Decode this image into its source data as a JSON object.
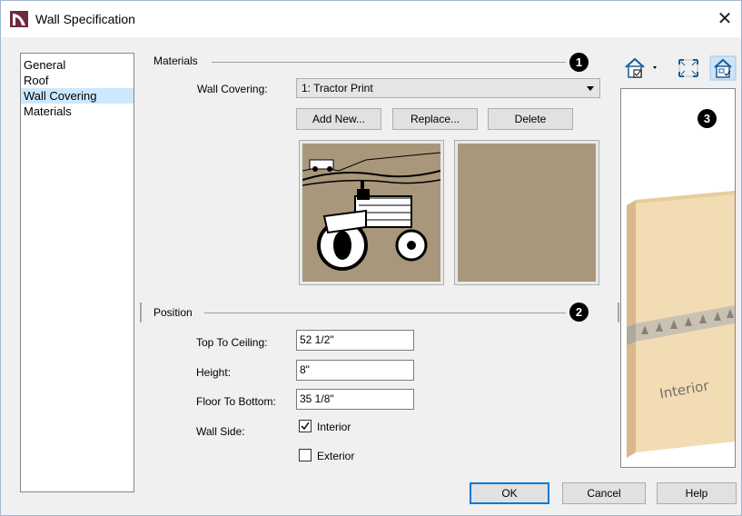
{
  "window": {
    "title": "Wall Specification"
  },
  "nav": {
    "items": [
      {
        "label": "General",
        "selected": false
      },
      {
        "label": "Roof",
        "selected": false
      },
      {
        "label": "Wall Covering",
        "selected": true
      },
      {
        "label": "Materials",
        "selected": false
      }
    ]
  },
  "materials": {
    "group_label": "Materials",
    "badge": "1",
    "wall_covering_label": "Wall Covering:",
    "wall_covering_value": "1:  Tractor Print",
    "add_new_label": "Add New...",
    "replace_label": "Replace...",
    "delete_label": "Delete",
    "swatch_color": "#a8977a"
  },
  "position": {
    "group_label": "Position",
    "badge": "2",
    "top_to_ceiling_label": "Top To Ceiling:",
    "top_to_ceiling_value": "52 1/2\"",
    "height_label": "Height:",
    "height_value": "8\"",
    "floor_to_bottom_label": "Floor To Bottom:",
    "floor_to_bottom_value": "35 1/8\"",
    "wall_side_label": "Wall Side:",
    "interior_label": "Interior",
    "interior_checked": true,
    "exterior_label": "Exterior",
    "exterior_checked": false
  },
  "preview": {
    "badge": "3",
    "caption": "Interior"
  },
  "footer": {
    "ok_label": "OK",
    "cancel_label": "Cancel",
    "help_label": "Help"
  },
  "colors": {
    "accent": "#0078d7",
    "selection": "#cce8ff",
    "panel": "#f0f0f0"
  }
}
